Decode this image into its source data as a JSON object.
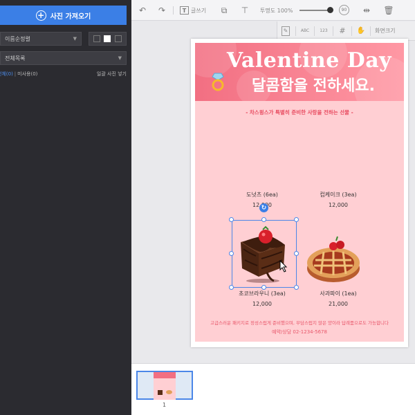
{
  "sidebar": {
    "import_label": "사진 가져오기",
    "sort_value": "이름순정렬",
    "category_value": "전체목록",
    "filter_all": "전체(0)",
    "filter_unused": "미사용(0)",
    "bulk_insert": "일괄 사진 넣기"
  },
  "toolbar": {
    "text_label": "글쓰기",
    "opacity_label": "투명도 100%",
    "opacity_value": 1.0,
    "page_size_label": "화면크기"
  },
  "design": {
    "title_en": "Valentine Day",
    "title_ko": "달콤함을 전하세요.",
    "subtitle": "- 차스윙스가 특별히 준비한 사랑을 전하는 선물 -",
    "products": [
      {
        "name": "도넛츠 (6ea)",
        "price": "12,000"
      },
      {
        "name": "컵케이크 (3ea)",
        "price": "12,000"
      },
      {
        "name": "초코브라우니 (3ea)",
        "price": "12,000"
      },
      {
        "name": "사과파이 (1ea)",
        "price": "21,000"
      }
    ],
    "footer_line1": "고급스러운 패키지로 정성스럽게 준비했으며, 부담스럽지 않은 양이라 답례품으로도 가능합니다",
    "footer_line2": "예약/상담 02-1234-5678"
  },
  "pages": {
    "current": "1"
  },
  "colors": {
    "accent": "#3b7fe6",
    "banner": "#f26f82",
    "background": "#ffcfd3"
  }
}
